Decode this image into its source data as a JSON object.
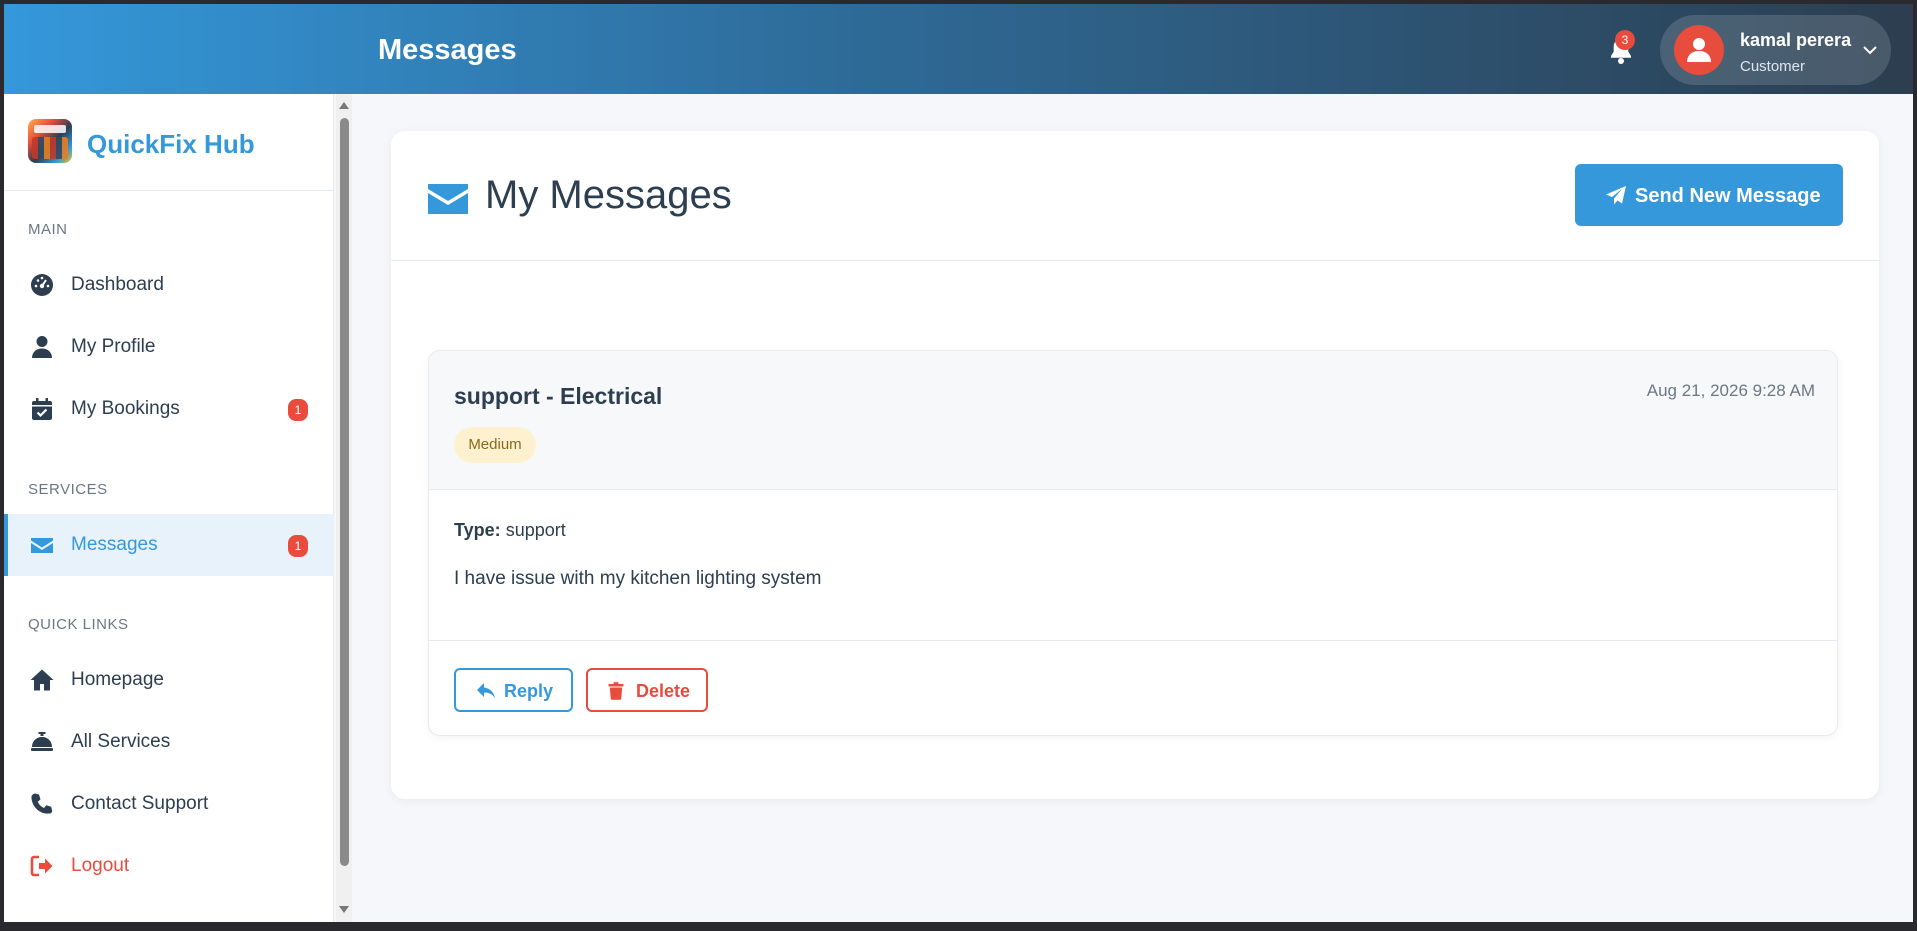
{
  "header": {
    "title": "Messages",
    "notification_count": "3",
    "user": {
      "name": "kamal perera",
      "role": "Customer"
    }
  },
  "sidebar": {
    "brand": "QuickFix Hub",
    "sections": {
      "main": "MAIN",
      "services": "SERVICES",
      "quick_links": "QUICK LINKS"
    },
    "items": {
      "dashboard": {
        "label": "Dashboard",
        "icon": "dashboard-icon"
      },
      "profile": {
        "label": "My Profile",
        "icon": "user-icon"
      },
      "bookings": {
        "label": "My Bookings",
        "icon": "calendar-check-icon",
        "badge": "1"
      },
      "messages": {
        "label": "Messages",
        "icon": "envelope-icon",
        "badge": "1"
      },
      "homepage": {
        "label": "Homepage",
        "icon": "home-icon"
      },
      "services": {
        "label": "All Services",
        "icon": "concierge-bell-icon"
      },
      "support": {
        "label": "Contact Support",
        "icon": "phone-icon"
      },
      "logout": {
        "label": "Logout",
        "icon": "sign-out-icon"
      }
    }
  },
  "main": {
    "title": "My Messages",
    "send_button": "Send New Message",
    "messages": [
      {
        "subject": "support - Electrical",
        "date": "Aug 21, 2026 9:28 AM",
        "priority": "Medium",
        "type_label": "Type:",
        "type_value": "support",
        "body": "I have issue with my kitchen lighting system",
        "reply_label": "Reply",
        "delete_label": "Delete"
      }
    ]
  },
  "colors": {
    "accent": "#3498db",
    "dark": "#2c3e50",
    "danger": "#e74c3c",
    "priority_bg": "#fdf1cf"
  }
}
